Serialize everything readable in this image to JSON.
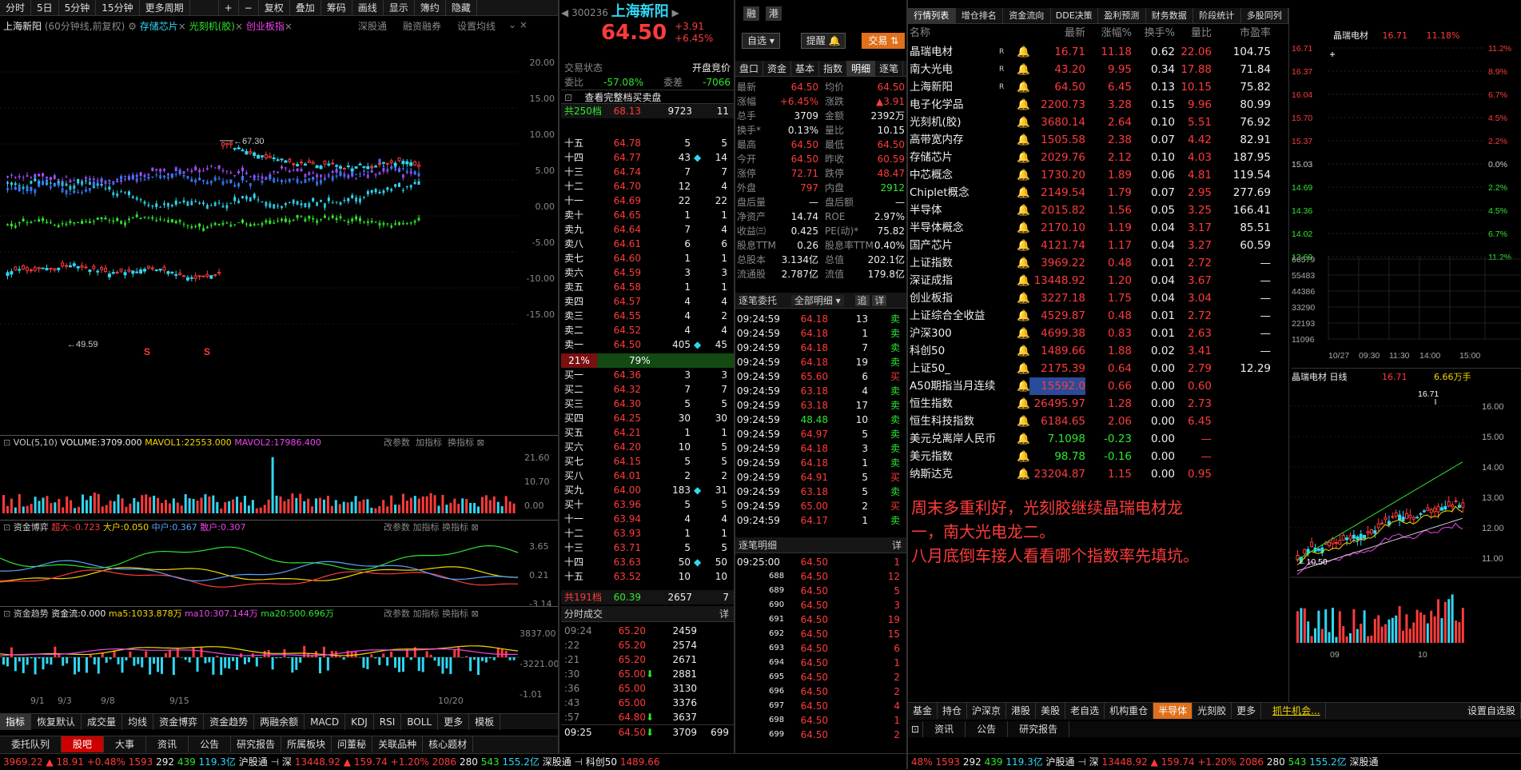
{
  "left_toolbar": [
    "分时",
    "5日",
    "5分钟",
    "15分钟",
    "更多周期",
    "+",
    "−",
    "复权",
    "叠加",
    "筹码",
    "画线",
    "显示",
    "簿约",
    "隐藏"
  ],
  "chart_header": {
    "stock": "上海新阳",
    "mode": "(60分钟线,前复权)",
    "overlays": [
      "存储芯片",
      "光刻机(胶)",
      "创业板指"
    ],
    "links": [
      "深股通",
      "融资融券",
      "设置均线"
    ]
  },
  "price_axis": [
    "20.00",
    "15.00",
    "10.00",
    "5.00",
    "0.00",
    "-5.00",
    "-10.00",
    "-15.00"
  ],
  "price_marks": {
    "high": "67.30",
    "low": "49.59"
  },
  "vol": {
    "label": "VOL(5,10)",
    "volume": "VOLUME:3709.000",
    "mavol1": "MAVOL1:22553.000",
    "mavol2": "MAVOL2:17986.400",
    "btns": [
      "改参数",
      "加指标",
      "换指标"
    ],
    "axis": [
      "21.60",
      "10.70",
      "0.00"
    ]
  },
  "zjbl": {
    "label": "资金博弈",
    "cd": "超大:-0.723",
    "dd": "大户:0.050",
    "zh": "中户:0.367",
    "sh": "散户:0.307",
    "axis": [
      "3.65",
      "0.21",
      "-3.14"
    ]
  },
  "zjqs": {
    "label": "资金趋势",
    "flow": "资金流:0.000",
    "ma5": "ma5:1033.878万",
    "ma10": "ma10:307.144万",
    "ma20": "ma20:500.696万",
    "axis": [
      "3837.00",
      "-3221.00",
      "-1.01"
    ]
  },
  "date_axis": [
    "9/1",
    "9/3",
    "9/8",
    "9/15",
    "10/20"
  ],
  "left_bottom_tabs": [
    "指标",
    "恢复默认",
    "成交量",
    "均线",
    "资金博弈",
    "资金趋势",
    "两融余额",
    "MACD",
    "KDJ",
    "RSI",
    "BOLL",
    "更多",
    "模板"
  ],
  "bottom_tabs": [
    "委托队列",
    "股吧",
    "大事",
    "资讯",
    "公告",
    "研究报告",
    "所属板块",
    "问董秘",
    "关联品种",
    "核心题材"
  ],
  "status": {
    "a": "3969.22",
    "b": "▲ 18.91",
    "c": "+0.48%",
    "d": "1593",
    "e": "292",
    "f": "439",
    "g": "119.3亿",
    "h": "沪股通",
    "i": "深",
    "j": "13448.92",
    "k": "▲ 159.74",
    "l": "+1.20%",
    "m": "2086",
    "n": "280",
    "o": "543",
    "p": "155.2亿",
    "q": "深股通",
    "r": "科创50",
    "s": "1489.66"
  },
  "quote": {
    "code": "300236",
    "name": "上海新阳",
    "tags": [
      "融",
      "港"
    ],
    "price": "64.50",
    "chg": "+3.91",
    "pct": "+6.45%",
    "btn_self": "自选",
    "btn_alert": "提醒",
    "btn_trade": "交易"
  },
  "trade_state": {
    "label": "交易状态",
    "val": "开盘竞价",
    "wb": "委比",
    "wbv": "-57.08%",
    "wc": "委差",
    "wcv": "-7066",
    "full": "查看完整档买卖盘"
  },
  "ask_total": {
    "lbl": "共250档",
    "p": "68.13",
    "v": "9723",
    "n": "11"
  },
  "asks": [
    [
      "十五",
      "64.78",
      "5",
      "5"
    ],
    [
      "十四",
      "64.77",
      "43",
      "14"
    ],
    [
      "十三",
      "64.74",
      "7",
      "7"
    ],
    [
      "十二",
      "64.70",
      "12",
      "4"
    ],
    [
      "十一",
      "64.69",
      "22",
      "22"
    ],
    [
      "卖十",
      "64.65",
      "1",
      "1"
    ],
    [
      "卖九",
      "64.64",
      "7",
      "4"
    ],
    [
      "卖八",
      "64.61",
      "6",
      "6"
    ],
    [
      "卖七",
      "64.60",
      "1",
      "1"
    ],
    [
      "卖六",
      "64.59",
      "3",
      "3"
    ],
    [
      "卖五",
      "64.58",
      "1",
      "1"
    ],
    [
      "卖四",
      "64.57",
      "4",
      "4"
    ],
    [
      "卖三",
      "64.55",
      "4",
      "2"
    ],
    [
      "卖二",
      "64.52",
      "4",
      "4"
    ],
    [
      "卖一",
      "64.50",
      "405",
      "45"
    ]
  ],
  "ratio": {
    "sell": "21%",
    "buy": "79%"
  },
  "bids": [
    [
      "买一",
      "64.36",
      "3",
      "3"
    ],
    [
      "买二",
      "64.32",
      "7",
      "7"
    ],
    [
      "买三",
      "64.30",
      "5",
      "5"
    ],
    [
      "买四",
      "64.25",
      "30",
      "30"
    ],
    [
      "买五",
      "64.21",
      "1",
      "1"
    ],
    [
      "买六",
      "64.20",
      "10",
      "5"
    ],
    [
      "买七",
      "64.15",
      "5",
      "5"
    ],
    [
      "买八",
      "64.01",
      "2",
      "2"
    ],
    [
      "买九",
      "64.00",
      "183",
      "31"
    ],
    [
      "买十",
      "63.96",
      "5",
      "5"
    ],
    [
      "十一",
      "63.94",
      "4",
      "4"
    ],
    [
      "十二",
      "63.93",
      "1",
      "1"
    ],
    [
      "十三",
      "63.71",
      "5",
      "5"
    ],
    [
      "十四",
      "63.63",
      "50",
      "50"
    ],
    [
      "十五",
      "63.52",
      "10",
      "10"
    ]
  ],
  "bid_total": {
    "lbl": "共191档",
    "p": "60.39",
    "v": "2657",
    "n": "7"
  },
  "fs_title": "分时成交",
  "fs_detail": "详",
  "fs": [
    [
      "09:24",
      "65.20",
      "2459"
    ],
    [
      ":22",
      "65.20",
      "2574"
    ],
    [
      ":21",
      "65.20",
      "2671"
    ],
    [
      ":30",
      "65.00",
      "2881"
    ],
    [
      ":36",
      "65.00",
      "3130"
    ],
    [
      ":43",
      "65.00",
      "3376"
    ],
    [
      ":57",
      "64.80",
      "3637"
    ],
    [
      "09:25",
      "64.50",
      "3709",
      "699"
    ]
  ],
  "mini_tabs": [
    "盘口",
    "资金",
    "基本",
    "指数",
    "明细",
    "逐笔"
  ],
  "stats": [
    [
      "最新",
      "64.50",
      "均价",
      "64.50"
    ],
    [
      "涨幅",
      "+6.45%",
      "涨跌",
      "▲3.91"
    ],
    [
      "总手",
      "3709",
      "金额",
      "2392万"
    ],
    [
      "换手*",
      "0.13%",
      "量比",
      "10.15"
    ],
    [
      "最高",
      "64.50",
      "最低",
      "64.50"
    ],
    [
      "今开",
      "64.50",
      "昨收",
      "60.59"
    ],
    [
      "涨停",
      "72.71",
      "跌停",
      "48.47"
    ],
    [
      "外盘",
      "797",
      "内盘",
      "2912"
    ],
    [
      "盘后量",
      "—",
      "盘后额",
      "—"
    ],
    [
      "净资产",
      "14.74",
      "ROE",
      "2.97%"
    ],
    [
      "收益㈢",
      "0.425",
      "PE(动)*",
      "75.82"
    ],
    [
      "股息TTM",
      "0.26",
      "股息率TTM",
      "0.40%"
    ],
    [
      "总股本",
      "3.134亿",
      "总值",
      "202.1亿"
    ],
    [
      "流通股",
      "2.787亿",
      "流值",
      "179.8亿"
    ]
  ],
  "zbwt": {
    "title": "逐笔委托",
    "sel": "全部明细",
    "b1": "追",
    "b2": "详"
  },
  "zbwt_rows": [
    [
      "09:24:59",
      "64.18",
      "13",
      "卖"
    ],
    [
      "09:24:59",
      "64.18",
      "1",
      "卖"
    ],
    [
      "09:24:59",
      "64.18",
      "7",
      "卖"
    ],
    [
      "09:24:59",
      "64.18",
      "19",
      "卖"
    ],
    [
      "09:24:59",
      "65.60",
      "6",
      "买"
    ],
    [
      "09:24:59",
      "63.18",
      "4",
      "卖"
    ],
    [
      "09:24:59",
      "63.18",
      "17",
      "卖"
    ],
    [
      "09:24:59",
      "48.48",
      "10",
      "卖"
    ],
    [
      "09:24:59",
      "64.97",
      "5",
      "卖"
    ],
    [
      "09:24:59",
      "64.18",
      "3",
      "卖"
    ],
    [
      "09:24:59",
      "64.18",
      "1",
      "卖"
    ],
    [
      "09:24:59",
      "64.91",
      "5",
      "买"
    ],
    [
      "09:24:59",
      "63.18",
      "5",
      "卖"
    ],
    [
      "09:24:59",
      "65.00",
      "2",
      "买"
    ],
    [
      "09:24:59",
      "64.17",
      "1",
      "卖"
    ]
  ],
  "zbmx": {
    "title": "逐笔明细",
    "d": "详"
  },
  "zbmx_rows": [
    [
      "09:25:00",
      "64.50",
      "1"
    ],
    [
      "688",
      "64.50",
      "12"
    ],
    [
      "689",
      "64.50",
      "5"
    ],
    [
      "690",
      "64.50",
      "3"
    ],
    [
      "691",
      "64.50",
      "19"
    ],
    [
      "692",
      "64.50",
      "15"
    ],
    [
      "693",
      "64.50",
      "6"
    ],
    [
      "694",
      "64.50",
      "1"
    ],
    [
      "695",
      "64.50",
      "2"
    ],
    [
      "696",
      "64.50",
      "2"
    ],
    [
      "697",
      "64.50",
      "4"
    ],
    [
      "698",
      "64.50",
      "1"
    ],
    [
      "699",
      "64.50",
      "2"
    ]
  ],
  "list_tabs": [
    "行情列表",
    "增仓排名",
    "资金流向",
    "DDE决策",
    "盈利预测",
    "财务数据",
    "阶段统计",
    "多股同列"
  ],
  "list_head": [
    "名称",
    "最新",
    "涨幅%",
    "换手%",
    "量比",
    "市盈率"
  ],
  "list": [
    [
      "晶瑞电材",
      "16.71",
      "11.18",
      "0.62",
      "22.06",
      "104.75",
      "R"
    ],
    [
      "南大光电",
      "43.20",
      "9.95",
      "0.34",
      "17.88",
      "71.84",
      "R"
    ],
    [
      "上海新阳",
      "64.50",
      "6.45",
      "0.13",
      "10.15",
      "75.82",
      "R"
    ],
    [
      "电子化学品",
      "2200.73",
      "3.28",
      "0.15",
      "9.96",
      "80.99",
      ""
    ],
    [
      "光刻机(胶)",
      "3680.14",
      "2.64",
      "0.10",
      "5.51",
      "76.92",
      ""
    ],
    [
      "高带宽内存",
      "1505.58",
      "2.38",
      "0.07",
      "4.42",
      "82.91",
      ""
    ],
    [
      "存储芯片",
      "2029.76",
      "2.12",
      "0.10",
      "4.03",
      "187.95",
      ""
    ],
    [
      "中芯概念",
      "1730.20",
      "1.89",
      "0.06",
      "4.81",
      "119.54",
      ""
    ],
    [
      "Chiplet概念",
      "2149.54",
      "1.79",
      "0.07",
      "2.95",
      "277.69",
      ""
    ],
    [
      "半导体",
      "2015.82",
      "1.56",
      "0.05",
      "3.25",
      "166.41",
      ""
    ],
    [
      "半导体概念",
      "2170.10",
      "1.19",
      "0.04",
      "3.17",
      "85.51",
      ""
    ],
    [
      "国产芯片",
      "4121.74",
      "1.17",
      "0.04",
      "3.27",
      "60.59",
      ""
    ],
    [
      "上证指数",
      "3969.22",
      "0.48",
      "0.01",
      "2.72",
      "—",
      ""
    ],
    [
      "深证成指",
      "13448.92",
      "1.20",
      "0.04",
      "3.67",
      "—",
      ""
    ],
    [
      "创业板指",
      "3227.18",
      "1.75",
      "0.04",
      "3.04",
      "—",
      ""
    ],
    [
      "上证综合全收益",
      "4529.87",
      "0.48",
      "0.01",
      "2.72",
      "—",
      ""
    ],
    [
      "沪深300",
      "4699.38",
      "0.83",
      "0.01",
      "2.63",
      "—",
      ""
    ],
    [
      "科创50",
      "1489.66",
      "1.88",
      "0.02",
      "3.41",
      "—",
      ""
    ],
    [
      "上证50_",
      "2175.39",
      "0.64",
      "0.00",
      "2.79",
      "12.29",
      ""
    ],
    [
      "A50期指当月连续",
      "15592.0",
      "0.66",
      "0.00",
      "0.60",
      "",
      ""
    ],
    [
      "恒生指数",
      "26495.97",
      "1.28",
      "0.00",
      "2.73",
      "",
      ""
    ],
    [
      "恒生科技指数",
      "6184.65",
      "2.06",
      "0.00",
      "6.45",
      "",
      ""
    ],
    [
      "美元兑离岸人民币",
      "7.1098",
      "-0.23",
      "0.00",
      "—",
      "",
      ""
    ],
    [
      "美元指数",
      "98.78",
      "-0.16",
      "0.00",
      "—",
      "",
      ""
    ],
    [
      "纳斯达克",
      "23204.87",
      "1.15",
      "0.00",
      "0.95",
      "",
      ""
    ]
  ],
  "note": [
    "周末多重利好，光刻胶继续晶瑞电材龙",
    "一，南大光电龙二。",
    "八月底倒车接人看看哪个指数率先填坑。"
  ],
  "mini_chart": {
    "name": "晶瑞电材",
    "price": "16.71",
    "pct": "11.18%",
    "left_axis": [
      "16.71",
      "16.37",
      "16.04",
      "15.70",
      "15.37",
      "15.03",
      "14.69",
      "14.36",
      "14.02",
      "13.69"
    ],
    "right_axis": [
      "11.2%",
      "8.9%",
      "6.7%",
      "4.5%",
      "2.2%",
      "0.0%",
      "2.2%",
      "4.5%",
      "6.7%",
      "11.2%"
    ],
    "vol_axis": [
      "66579",
      "55483",
      "44386",
      "33290",
      "22193",
      "11096"
    ],
    "times": [
      "10/27",
      "09:30",
      "11:30",
      "14:00",
      "15:00"
    ]
  },
  "daily": {
    "name": "晶瑞电材",
    "type": "日线",
    "price": "16.71",
    "vol": "6.66万手",
    "high": "16.71",
    "low": "10.50",
    "axis": [
      "16.00",
      "15.00",
      "14.00",
      "13.00",
      "12.00",
      "11.00"
    ],
    "dates": [
      "09",
      "10"
    ]
  },
  "right_bottom_tabs": [
    "基金",
    "持仓",
    "沪深京",
    "港股",
    "美股",
    "老自选",
    "机构重仓",
    "半导体",
    "光刻胶",
    "更多",
    "抓牛机会...",
    "设置自选股"
  ],
  "right_sub_tabs": [
    "资讯",
    "公告",
    "研究报告"
  ],
  "right_status": {
    "a": "48%",
    "b": "1593",
    "c": "292",
    "d": "439",
    "e": "119.3亿",
    "f": "沪股通",
    "g": "深",
    "h": "13448.92",
    "i": "▲ 159.74",
    "j": "+1.20%",
    "k": "2086",
    "l": "280",
    "m": "543",
    "n": "155.2亿",
    "o": "深股通"
  },
  "colors": {
    "up": "#ff3b3b",
    "down": "#2ee82e",
    "accent": "#f5d800",
    "bg": "#000000"
  }
}
